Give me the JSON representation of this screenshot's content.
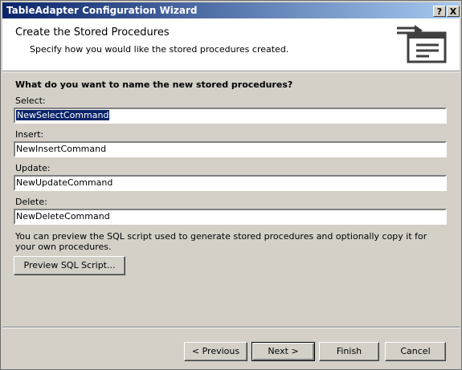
{
  "window": {
    "title": "TableAdapter Configuration Wizard",
    "help_label": "?",
    "close_label": "X"
  },
  "header": {
    "title": "Create the Stored Procedures",
    "subtitle": "Specify how you would like the stored procedures created."
  },
  "main": {
    "question": "What do you want to name the new stored procedures?",
    "fields": [
      {
        "label": "Select:",
        "value": "NewSelectCommand"
      },
      {
        "label": "Insert:",
        "value": "NewInsertCommand"
      },
      {
        "label": "Update:",
        "value": "NewUpdateCommand"
      },
      {
        "label": "Delete:",
        "value": "NewDeleteCommand"
      }
    ],
    "description": "You can preview the SQL script used to generate stored procedures and optionally copy it for your own procedures.",
    "preview_label": "Preview SQL Script..."
  },
  "footer": {
    "previous_label": "< Previous",
    "next_label": "Next >",
    "finish_label": "Finish",
    "cancel_label": "Cancel"
  },
  "colors": {
    "titlebar_start": "#0a246a",
    "titlebar_end": "#a6caf0",
    "face": "#d4d0c8",
    "selection": "#0a246a"
  }
}
